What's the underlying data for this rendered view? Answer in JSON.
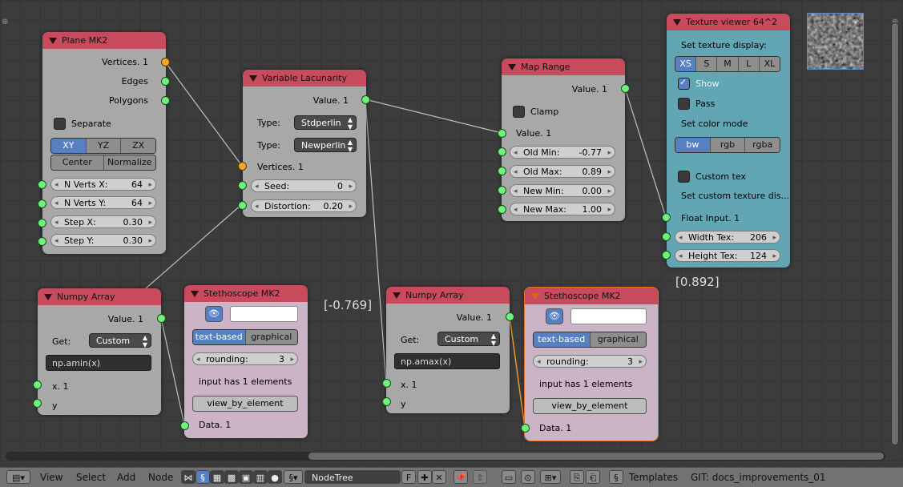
{
  "nodes": {
    "plane": {
      "title": "Plane MK2",
      "outputs": [
        "Vertices. 1",
        "Edges",
        "Polygons"
      ],
      "separate_label": "Separate",
      "dir_options": [
        "XY",
        "YZ",
        "ZX"
      ],
      "dir_selected": "XY",
      "center_label": "Center",
      "normalize_label": "Normalize",
      "params": [
        {
          "label": "N Verts X:",
          "value": "64"
        },
        {
          "label": "N Verts Y:",
          "value": "64"
        },
        {
          "label": "Step X:",
          "value": "0.30"
        },
        {
          "label": "Step Y:",
          "value": "0.30"
        }
      ]
    },
    "lacunarity": {
      "title": "Variable Lacunarity",
      "output": "Value. 1",
      "type_label": "Type:",
      "type1_value": "Stdperlin",
      "type2_value": "Newperlin",
      "input_vertices": "Vertices. 1",
      "params": [
        {
          "label": "Seed:",
          "value": "0"
        },
        {
          "label": "Distortion:",
          "value": "0.20"
        }
      ]
    },
    "maprange": {
      "title": "Map Range",
      "output": "Value. 1",
      "clamp_label": "Clamp",
      "input_value": "Value. 1",
      "params": [
        {
          "label": "Old Min:",
          "value": "-0.77"
        },
        {
          "label": "Old Max:",
          "value": "0.89"
        },
        {
          "label": "New Min:",
          "value": "0.00"
        },
        {
          "label": "New Max:",
          "value": "1.00"
        }
      ]
    },
    "texture": {
      "title": "Texture viewer 64^2",
      "set_display": "Set texture display:",
      "sizes": [
        "XS",
        "S",
        "M",
        "L",
        "XL"
      ],
      "size_selected": "XS",
      "show_label": "Show",
      "pass_label": "Pass",
      "color_mode_label": "Set color mode",
      "color_modes": [
        "bw",
        "rgb",
        "rgba"
      ],
      "color_selected": "bw",
      "custom_tex_label": "Custom tex",
      "custom_display_label": "Set custom texture dis...",
      "float_input": "Float Input. 1",
      "params": [
        {
          "label": "Width Tex:",
          "value": "206"
        },
        {
          "label": "Height Tex:",
          "value": "124"
        }
      ]
    },
    "numpy1": {
      "title": "Numpy Array",
      "output": "Value. 1",
      "get_label": "Get:",
      "get_value": "Custom",
      "expr": "np.amin(x)",
      "inputs": [
        "x. 1",
        "y"
      ]
    },
    "steth1": {
      "title": "Stethoscope MK2",
      "modes": [
        "text-based",
        "graphical"
      ],
      "mode_selected": "text-based",
      "rounding_label": "rounding:",
      "rounding_value": "3",
      "info": "input has 1 elements",
      "view_button": "view_by_element",
      "input": "Data. 1"
    },
    "numpy2": {
      "title": "Numpy Array",
      "output": "Value. 1",
      "get_label": "Get:",
      "get_value": "Custom",
      "expr": "np.amax(x)",
      "inputs": [
        "x. 1",
        "y"
      ]
    },
    "steth2": {
      "title": "Stethoscope MK2",
      "modes": [
        "text-based",
        "graphical"
      ],
      "mode_selected": "text-based",
      "rounding_label": "rounding:",
      "rounding_value": "3",
      "info": "input has 1 elements",
      "view_button": "view_by_element",
      "input": "Data. 1"
    }
  },
  "readouts": {
    "min_value": "[-0.769]",
    "max_value": "[0.892]"
  },
  "header": {
    "menus": [
      "View",
      "Select",
      "Add",
      "Node"
    ],
    "node_tree": "NodeTree",
    "fake_user": "F",
    "templates": "Templates",
    "git": "GIT: docs_improvements_01"
  },
  "colors": {
    "header_red": "#c74b5d",
    "socket_green": "#6ff27a",
    "socket_orange": "#f5a623",
    "selected_blue": "#5680c2",
    "texture_bg": "#62a6b4"
  }
}
